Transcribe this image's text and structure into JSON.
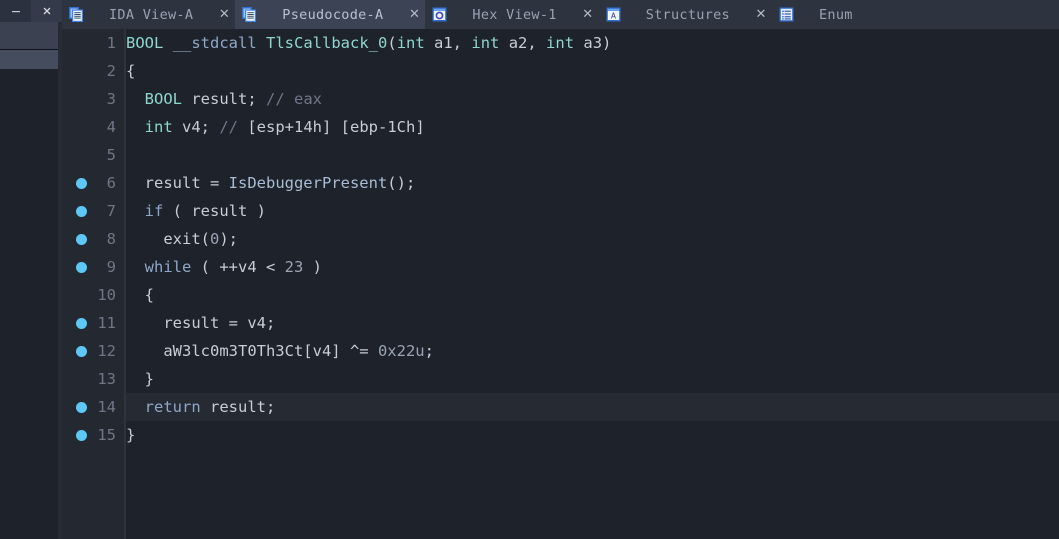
{
  "window": {
    "minimize_label": "—",
    "close_label": "✕"
  },
  "sidebar": {
    "name": "navigator-panel"
  },
  "tabs": [
    {
      "label": "IDA View-A",
      "icon": "document-list-icon",
      "close_label": "✕",
      "active": false
    },
    {
      "label": "Pseudocode-A",
      "icon": "document-list-icon",
      "close_label": "✕",
      "active": true
    },
    {
      "label": "Hex View-1",
      "icon": "hex-window-icon",
      "close_label": "✕",
      "active": false
    },
    {
      "label": "Structures",
      "icon": "structures-icon",
      "close_label": "✕",
      "active": false
    },
    {
      "label": "Enum",
      "icon": "enums-icon",
      "close_label": "",
      "active": false
    }
  ],
  "editor": {
    "colors": {
      "background": "#1e222b",
      "gutter": "#232831",
      "current_line": "#262a33",
      "breakpoint": "#5ec8f5",
      "line_number": "#6f7787",
      "type": "#8fd6cf",
      "keyword": "#8fa7c7",
      "comment": "#6e7587",
      "text": "#c7ccd6"
    },
    "lines": [
      {
        "n": "1",
        "bp": false,
        "hl": false,
        "tokens": [
          {
            "t": "BOOL",
            "c": "t-type"
          },
          {
            "t": " ",
            "c": "t-plain"
          },
          {
            "t": "__stdcall",
            "c": "t-kw"
          },
          {
            "t": " ",
            "c": "t-plain"
          },
          {
            "t": "TlsCallback_0",
            "c": "t-fn"
          },
          {
            "t": "(",
            "c": "t-plain"
          },
          {
            "t": "int",
            "c": "t-type"
          },
          {
            "t": " a1, ",
            "c": "t-plain"
          },
          {
            "t": "int",
            "c": "t-type"
          },
          {
            "t": " a2, ",
            "c": "t-plain"
          },
          {
            "t": "int",
            "c": "t-type"
          },
          {
            "t": " a3)",
            "c": "t-plain"
          }
        ]
      },
      {
        "n": "2",
        "bp": false,
        "hl": false,
        "tokens": [
          {
            "t": "{",
            "c": "t-plain"
          }
        ]
      },
      {
        "n": "3",
        "bp": false,
        "hl": false,
        "tokens": [
          {
            "t": "  ",
            "c": "t-plain"
          },
          {
            "t": "BOOL",
            "c": "t-type"
          },
          {
            "t": " result; ",
            "c": "t-plain"
          },
          {
            "t": "// eax",
            "c": "t-com"
          }
        ]
      },
      {
        "n": "4",
        "bp": false,
        "hl": false,
        "tokens": [
          {
            "t": "  ",
            "c": "t-plain"
          },
          {
            "t": "int",
            "c": "t-type"
          },
          {
            "t": " v4; ",
            "c": "t-plain"
          },
          {
            "t": "// ",
            "c": "t-com"
          },
          {
            "t": "[esp+14h] [ebp-1Ch]",
            "c": "t-plain"
          }
        ]
      },
      {
        "n": "5",
        "bp": false,
        "hl": false,
        "tokens": []
      },
      {
        "n": "6",
        "bp": true,
        "hl": false,
        "tokens": [
          {
            "t": "  result = ",
            "c": "t-plain"
          },
          {
            "t": "IsDebuggerPresent",
            "c": "t-api"
          },
          {
            "t": "();",
            "c": "t-plain"
          }
        ]
      },
      {
        "n": "7",
        "bp": true,
        "hl": false,
        "tokens": [
          {
            "t": "  ",
            "c": "t-plain"
          },
          {
            "t": "if",
            "c": "t-kw"
          },
          {
            "t": " ( result )",
            "c": "t-plain"
          }
        ]
      },
      {
        "n": "8",
        "bp": true,
        "hl": false,
        "tokens": [
          {
            "t": "    exit(",
            "c": "t-plain"
          },
          {
            "t": "0",
            "c": "t-num"
          },
          {
            "t": ");",
            "c": "t-plain"
          }
        ]
      },
      {
        "n": "9",
        "bp": true,
        "hl": false,
        "tokens": [
          {
            "t": "  ",
            "c": "t-plain"
          },
          {
            "t": "while",
            "c": "t-kw"
          },
          {
            "t": " ( ++v4 < ",
            "c": "t-plain"
          },
          {
            "t": "23",
            "c": "t-num"
          },
          {
            "t": " )",
            "c": "t-plain"
          }
        ]
      },
      {
        "n": "10",
        "bp": false,
        "hl": false,
        "tokens": [
          {
            "t": "  {",
            "c": "t-plain"
          }
        ]
      },
      {
        "n": "11",
        "bp": true,
        "hl": false,
        "tokens": [
          {
            "t": "    result = v4;",
            "c": "t-plain"
          }
        ]
      },
      {
        "n": "12",
        "bp": true,
        "hl": false,
        "tokens": [
          {
            "t": "    aW3lc0m3T0Th3Ct[v4] ^= ",
            "c": "t-plain"
          },
          {
            "t": "0x22u",
            "c": "t-num"
          },
          {
            "t": ";",
            "c": "t-plain"
          }
        ]
      },
      {
        "n": "13",
        "bp": false,
        "hl": false,
        "tokens": [
          {
            "t": "  }",
            "c": "t-plain"
          }
        ]
      },
      {
        "n": "14",
        "bp": true,
        "hl": true,
        "tokens": [
          {
            "t": "  ",
            "c": "t-plain"
          },
          {
            "t": "return",
            "c": "t-kw"
          },
          {
            "t": " result;",
            "c": "t-plain"
          }
        ]
      },
      {
        "n": "15",
        "bp": true,
        "hl": false,
        "tokens": [
          {
            "t": "}",
            "c": "t-plain"
          }
        ]
      }
    ]
  }
}
